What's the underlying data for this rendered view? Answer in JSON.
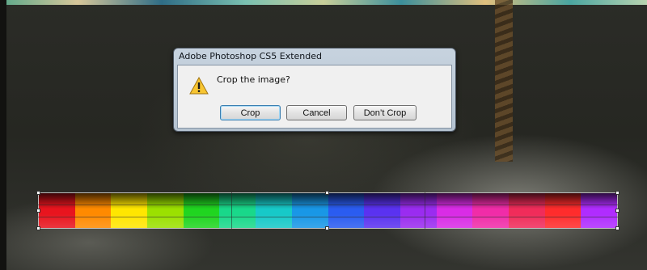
{
  "dialog": {
    "title": "Adobe Photoshop CS5 Extended",
    "message": "Crop the image?",
    "icon": "warning-icon",
    "buttons": {
      "crop": "Crop",
      "cancel": "Cancel",
      "dont_crop": "Don’t Crop"
    }
  },
  "swatch_colors": [
    "#e8141e",
    "#ff8a00",
    "#ffe600",
    "#9be000",
    "#20d520",
    "#19d88a",
    "#17c9c8",
    "#1997e6",
    "#2a5cf0",
    "#5a32f0",
    "#9a2cf0",
    "#d92ce6",
    "#f02ca8",
    "#f02c5a",
    "#ff2c2c",
    "#b02cff"
  ]
}
